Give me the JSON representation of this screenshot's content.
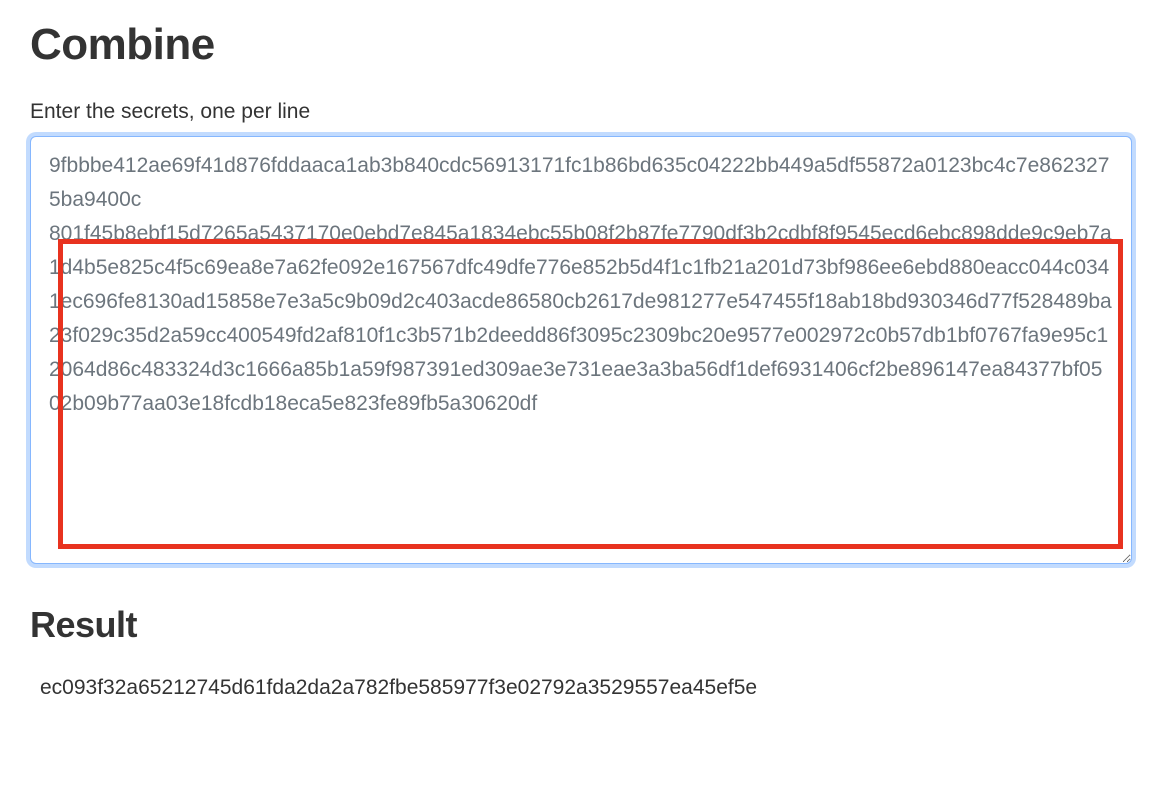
{
  "combine": {
    "heading": "Combine",
    "input_label": "Enter the secrets, one per line",
    "textarea_value": "9fbbbe412ae69f41d876fddaaca1ab3b840cdc56913171fc1b86bd635c04222bb449a5df55872a0123bc4c7e8623275ba9400c\n801f45b8ebf15d7265a5437170e0ebd7e845a1834ebc55b08f2b87fe7790df3b2cdbf8f9545ecd6ebc898dde9c9eb7a1d4b5e825c4f5c69ea8e7a62fe092e167567dfc49dfe776e852b5d4f1c1fb21a201d73bf986ee6ebd880eacc044c0341ec696fe8130ad15858e7e3a5c9b09d2c403acde86580cb2617de981277e547455f18ab18bd930346d77f528489ba23f029c35d2a59cc400549fd2af810f1c3b571b2deedd86f3095c2309bc20e9577e002972c0b57db1bf0767fa9e95c12064d86c483324d3c1666a85b1a59f987391ed309ae3e731eae3a3ba56df1def6931406cf2be896147ea84377bf0502b09b77aa03e18fcdb18eca5e823fe89fb5a30620df"
  },
  "result": {
    "heading": "Result",
    "value": "ec093f32a65212745d61fda2da2a782fbe585977f3e02792a3529557ea45ef5e"
  }
}
